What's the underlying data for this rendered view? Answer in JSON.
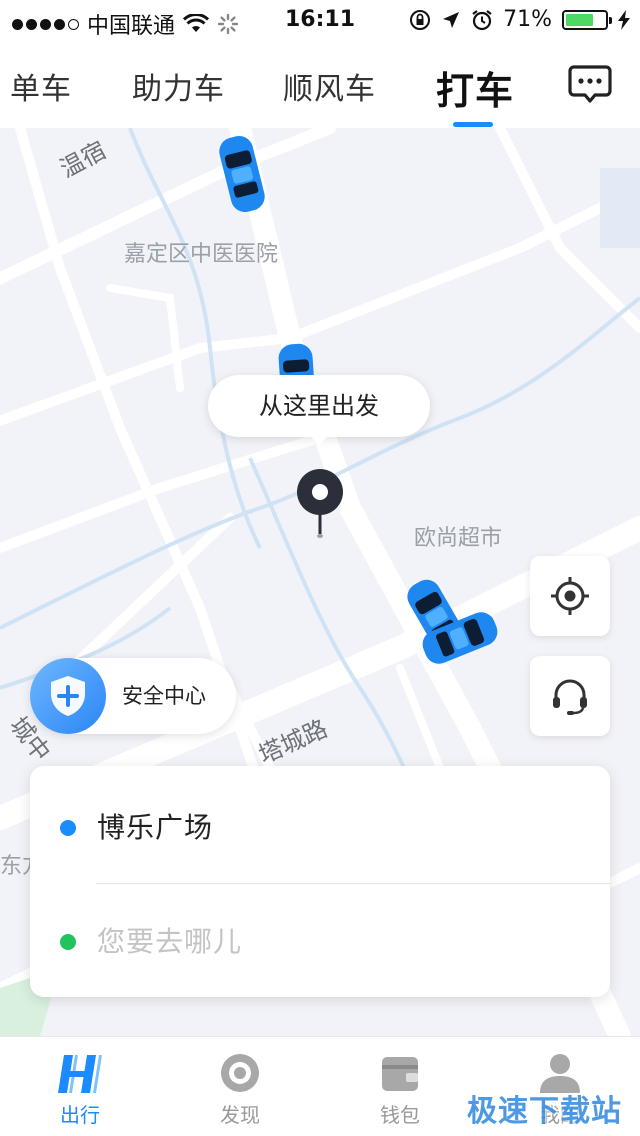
{
  "status_bar": {
    "carrier": "中国联通",
    "time": "16:11",
    "battery_percent": "71%",
    "battery_level": 0.71
  },
  "top_tabs": {
    "items": [
      {
        "label": "单车"
      },
      {
        "label": "助力车"
      },
      {
        "label": "顺风车"
      },
      {
        "label": "打车",
        "active": true
      }
    ],
    "accent_color": "#1a8cff"
  },
  "map": {
    "labels": {
      "hospital": "嘉定区中医医院",
      "supermarket": "欧尚超市",
      "road_top": "温宿",
      "road_bottom": "塔城路",
      "road_left": "城中",
      "place_left": "东方"
    },
    "pickup_tooltip": "从这里出发",
    "safety_center_label": "安全中心"
  },
  "trip": {
    "origin": "博乐广场",
    "destination_placeholder": "您要去哪儿",
    "origin_color": "#1a8cff",
    "destination_color": "#21c45c"
  },
  "bottom_nav": {
    "items": [
      {
        "label": "出行",
        "icon": "ride-logo-icon",
        "active": true
      },
      {
        "label": "发现",
        "icon": "discover-icon"
      },
      {
        "label": "钱包",
        "icon": "wallet-icon"
      },
      {
        "label": "我的",
        "icon": "profile-icon"
      }
    ]
  },
  "watermark": "极速下载站"
}
